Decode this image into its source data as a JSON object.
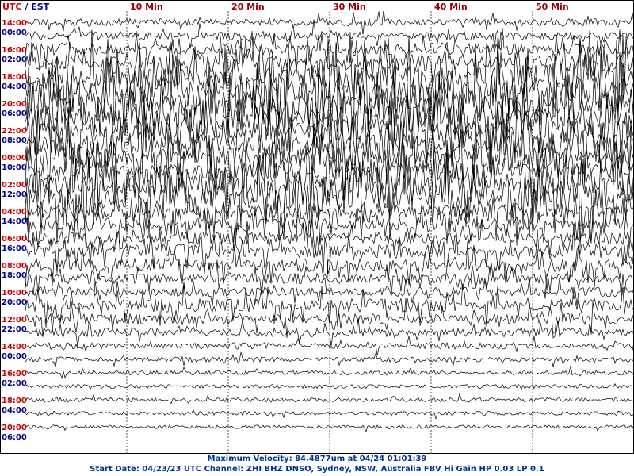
{
  "header": {
    "utc_label": "UTC",
    "separator": " / ",
    "local_label": "EST"
  },
  "colors": {
    "utc_text": "#cc0000",
    "local_text": "#000088",
    "minute_label": "#990000",
    "caption": "#003399",
    "trace": "#000000",
    "hour_line": "#000000",
    "border": "#000000"
  },
  "chart_data": {
    "type": "line",
    "subtype": "helicorder",
    "title": "Maximum Velocity: 84.4877um at 04/24 01:01:39",
    "subtitle": "Start Date: 04/23/23 UTC Channel: ZHI  BHZ  DNSO, Sydney, NSW, Australia  FBV Hi Gain HP 0.03  LP 0.1",
    "x_tick_labels": [
      "10 Min",
      "20 Min",
      "30 Min",
      "40 Min",
      "50 Min"
    ],
    "x_ticks_minutes": [
      10,
      20,
      30,
      40,
      50
    ],
    "x_range_minutes": [
      0,
      60
    ],
    "gridlines": "dashed vertical at each tick",
    "utc_labels": [
      "14:00",
      "16:00",
      "18:00",
      "20:00",
      "22:00",
      "00:00",
      "02:00",
      "04:00",
      "06:00",
      "08:00",
      "10:00",
      "12:00",
      "14:00",
      "16:00",
      "18:00",
      "20:00"
    ],
    "est_labels": [
      "00:00",
      "02:00",
      "04:00",
      "06:00",
      "08:00",
      "10:00",
      "12:00",
      "14:00",
      "16:00",
      "18:00",
      "20:00",
      "22:00",
      "00:00",
      "02:00",
      "04:00",
      "06:00"
    ],
    "rows_per_label": 2,
    "row_count": 31,
    "max_velocity_um": 84.4877,
    "max_velocity_time": "04/24 01:01:39",
    "activity_profile": [
      0.25,
      0.3,
      0.45,
      0.65,
      0.95,
      1.0,
      0.95,
      0.9,
      0.85,
      0.95,
      0.85,
      0.7,
      0.9,
      1.0,
      0.6,
      0.5,
      0.45,
      0.55,
      0.5,
      0.4,
      0.35,
      0.5,
      0.4,
      0.3,
      0.2,
      0.15,
      0.12,
      0.1,
      0.12,
      0.1,
      0.08
    ]
  },
  "footer": {
    "velocity_line": "Maximum Velocity: 84.4877um at 04/24 01:01:39",
    "start_line": "Start Date: 04/23/23 UTC Channel: ZHI  BHZ  DNSO, Sydney, NSW, Australia  FBV Hi Gain HP 0.03  LP 0.1"
  }
}
